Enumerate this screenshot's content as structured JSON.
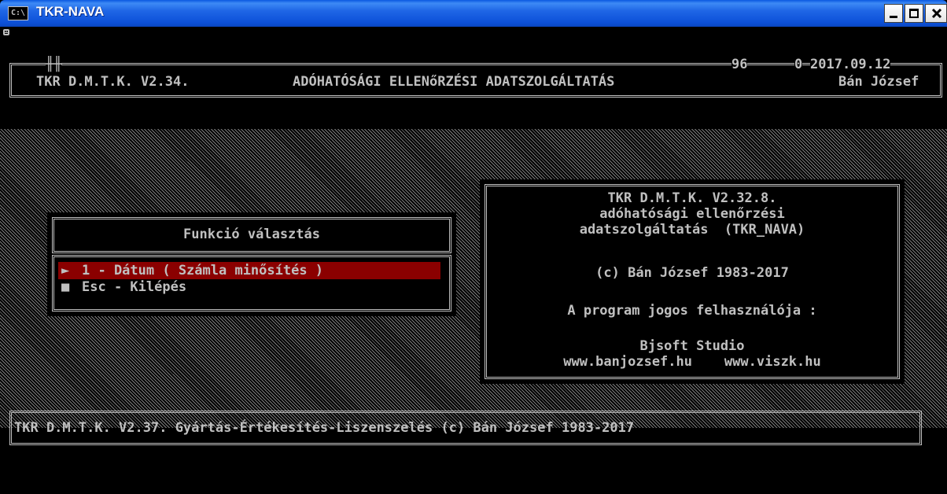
{
  "window": {
    "title": "TKR-NAVA",
    "icon_label": "C:\\"
  },
  "header": {
    "program": "TKR D.M.T.K. V2.34.",
    "service": "ADÓHATÓSÁGI ELLENőRZÉSI ADATSZOLGÁLTATÁS",
    "user": "Bán József",
    "counter1": "96",
    "counter2": "0",
    "date": "2017.09.12"
  },
  "menu": {
    "title": "Funkció választás",
    "items": [
      {
        "marker": "►",
        "label": "1 - Dátum ( Számla minősítés )",
        "selected": true
      },
      {
        "marker": "■",
        "label": "Esc - Kilépés",
        "selected": false
      }
    ]
  },
  "info": {
    "lines": [
      "TKR D.M.T.K. V2.32.8.",
      "adóhatósági ellenőrzési",
      "adatszolgáltatás  (TKR_NAVA)",
      "(c) Bán József 1983-2017",
      "A program jogos felhasználója :",
      "Bjsoft Studio",
      "www.banjozsef.hu    www.viszk.hu"
    ]
  },
  "footer": {
    "text": "TKR D.M.T.K. V2.37. Gyártás-Értékesítés-Liszenszelés (c) Bán József 1983-2017"
  },
  "colors": {
    "console_text": "#c0c0c0",
    "highlight": "#8b0000",
    "titlebar": "#0c50d8"
  }
}
